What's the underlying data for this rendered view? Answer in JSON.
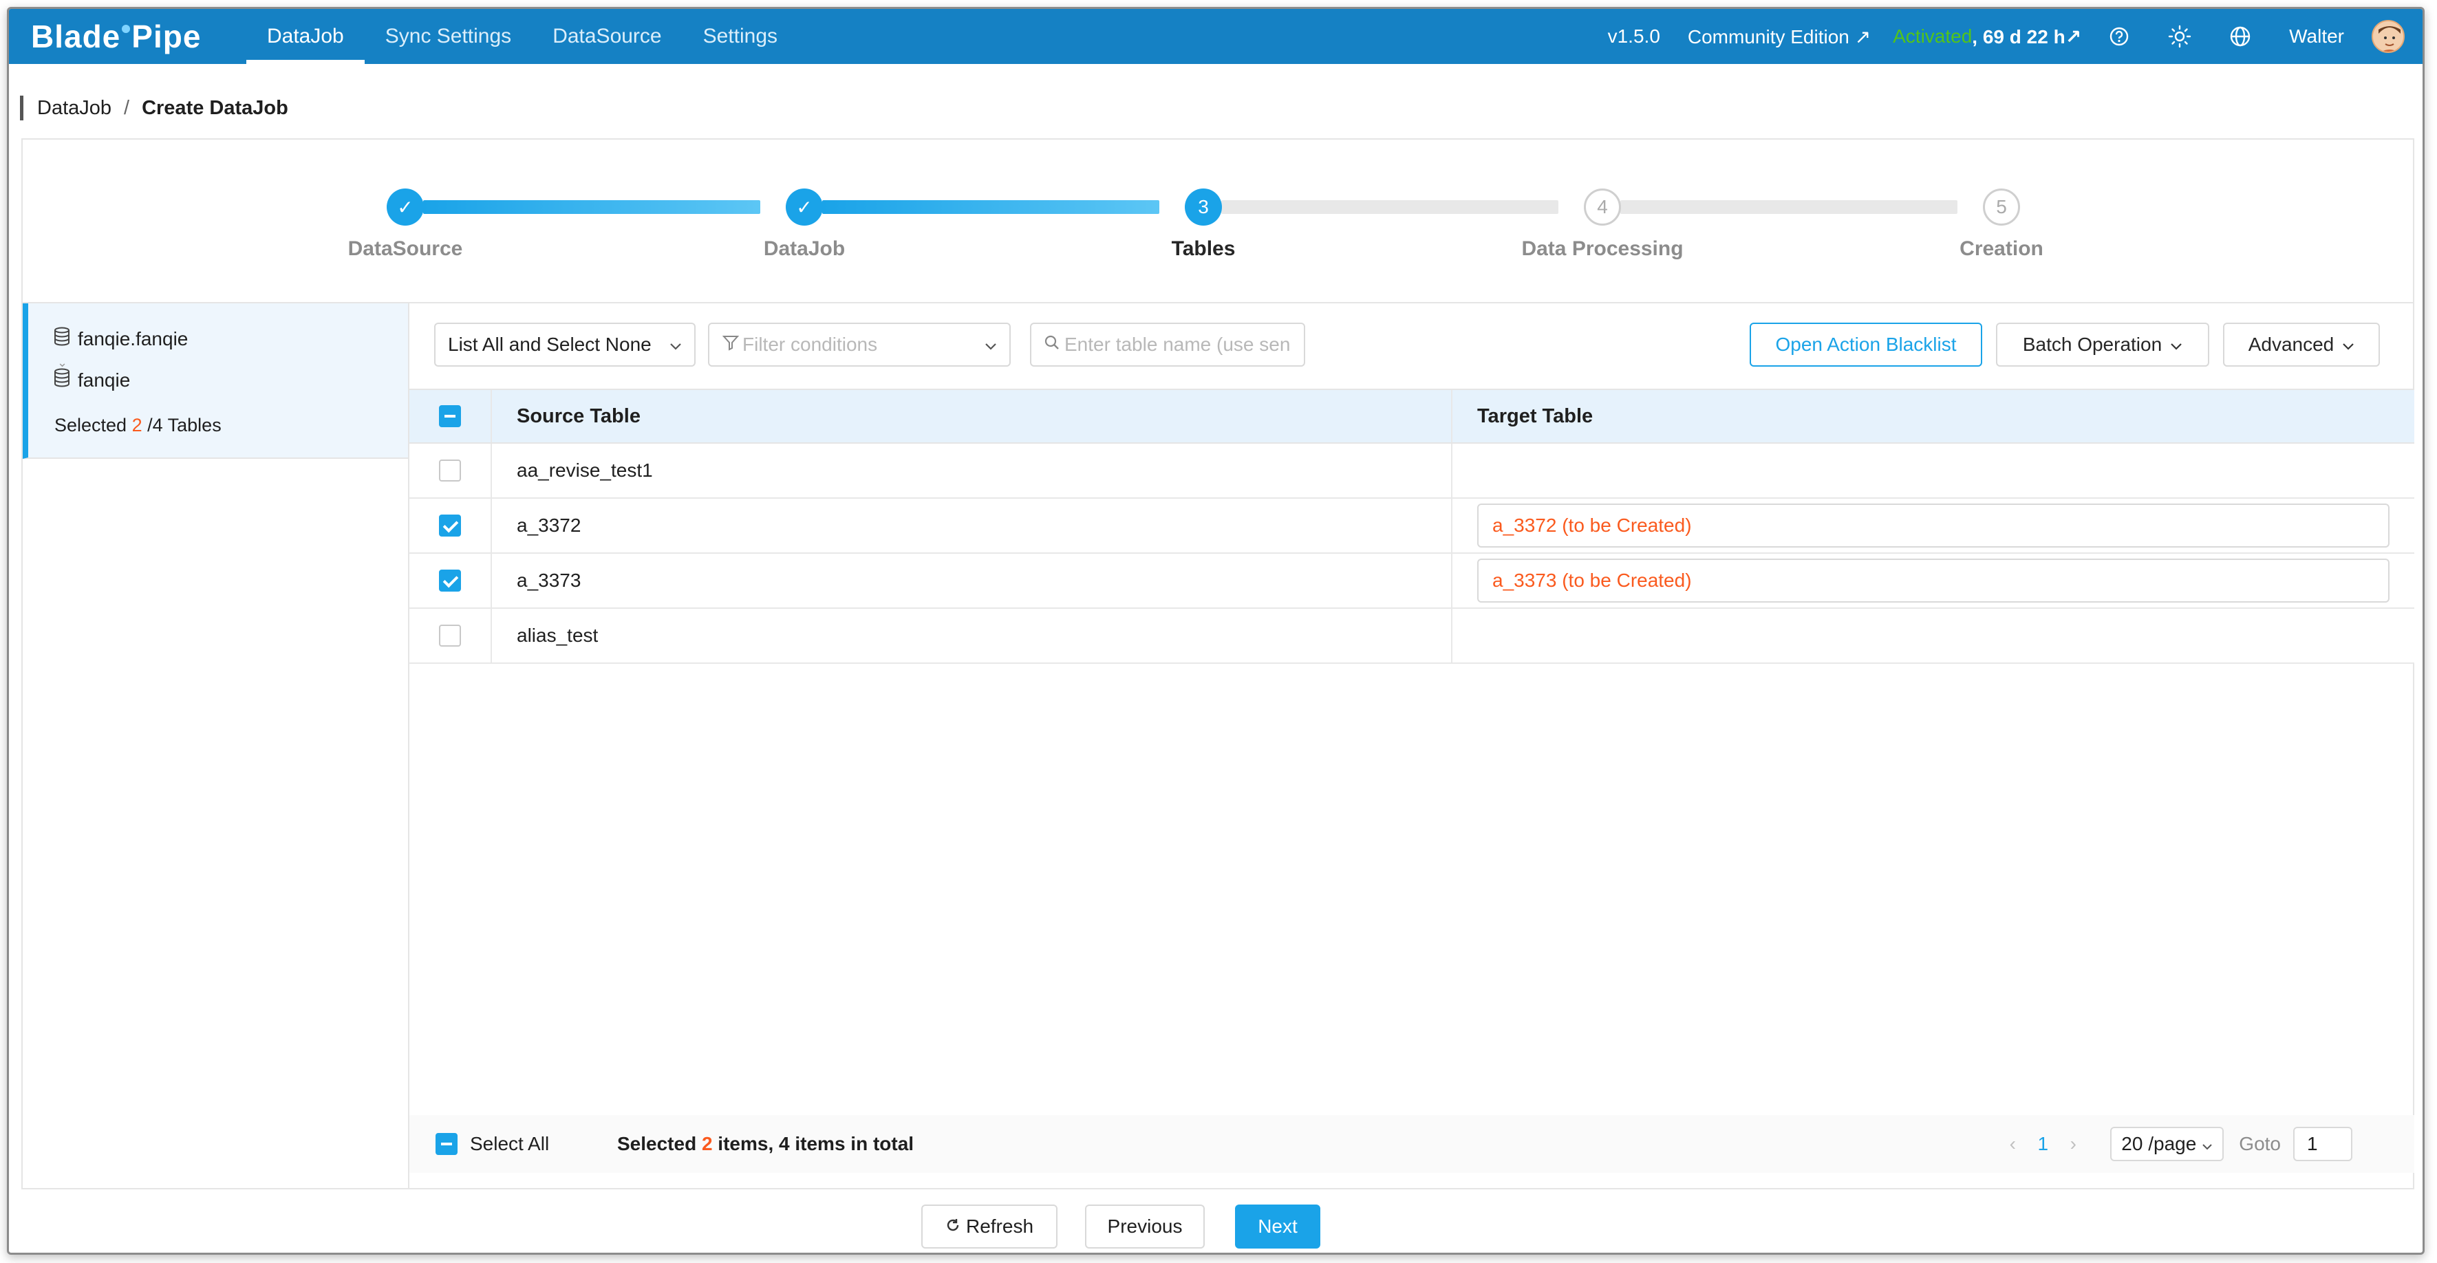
{
  "app": {
    "logo_text_a": "Blade",
    "logo_text_b": "Pipe"
  },
  "nav": {
    "items": [
      {
        "label": "DataJob"
      },
      {
        "label": "Sync Settings"
      },
      {
        "label": "DataSource"
      },
      {
        "label": "Settings"
      }
    ],
    "version": "v1.5.0",
    "edition": "Community Edition ↗",
    "activated": "Activated",
    "days": ", 69 d 22 h↗",
    "user": "Walter"
  },
  "breadcrumb": {
    "root": "DataJob",
    "sep": "/",
    "current": "Create DataJob"
  },
  "steps": [
    {
      "label": "DataSource",
      "marker": "✓"
    },
    {
      "label": "DataJob",
      "marker": "✓"
    },
    {
      "label": "Tables",
      "marker": "3"
    },
    {
      "label": "Data Processing",
      "marker": "4"
    },
    {
      "label": "Creation",
      "marker": "5"
    }
  ],
  "schema": {
    "source": "fanqie.fanqie",
    "target": "fanqie",
    "selected_prefix": "Selected ",
    "selected_count": "2",
    "selected_suffix": " /4 Tables"
  },
  "toolbar": {
    "list_select": "List All and Select None",
    "filter_placeholder": "Filter conditions",
    "search_placeholder": "Enter table name (use sen",
    "blacklist_btn": "Open Action Blacklist",
    "batch_btn": "Batch Operation",
    "advanced_btn": "Advanced"
  },
  "table": {
    "headers": {
      "source": "Source Table",
      "target": "Target Table"
    },
    "rows": [
      {
        "source": "aa_revise_test1",
        "target": "",
        "checked": false
      },
      {
        "source": "a_3372",
        "target": "a_3372 (to be Created)",
        "checked": true
      },
      {
        "source": "a_3373",
        "target": "a_3373 (to be Created)",
        "checked": true
      },
      {
        "source": "alias_test",
        "target": "",
        "checked": false
      }
    ]
  },
  "footer": {
    "select_all": "Select All",
    "summary_prefix": "Selected ",
    "summary_count": "2",
    "summary_suffix": " items, 4 items in total",
    "page": "1",
    "page_size": "20 /page",
    "goto_label": "Goto",
    "goto_value": "1"
  },
  "actions": {
    "refresh": "Refresh",
    "previous": "Previous",
    "next": "Next"
  },
  "colors": {
    "nav_bg": "#1581c4",
    "accent": "#1aa3e8",
    "highlight": "#fa5a1e",
    "activated": "#52c41a"
  }
}
